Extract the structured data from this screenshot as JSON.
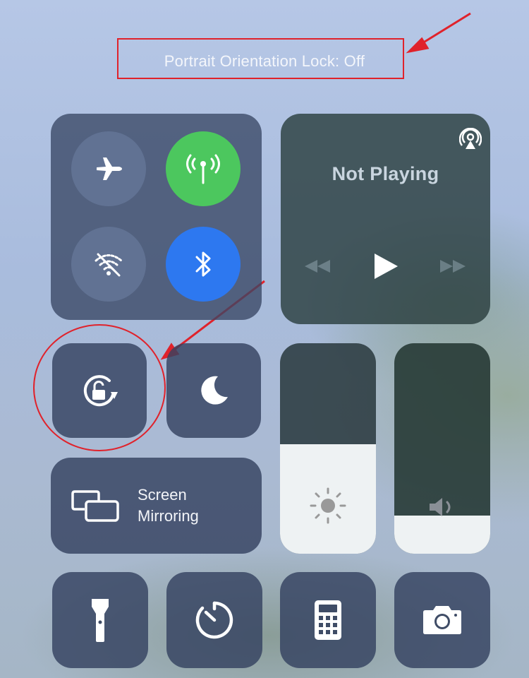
{
  "status": {
    "text": "Portrait Orientation Lock: Off"
  },
  "connectivity": {
    "items": [
      {
        "name": "airplane-mode",
        "icon": "airplane-icon",
        "state": "off"
      },
      {
        "name": "cellular-data",
        "icon": "antenna-icon",
        "state": "on",
        "color": "#4cc75e"
      },
      {
        "name": "wifi",
        "icon": "wifi-off-icon",
        "state": "off"
      },
      {
        "name": "bluetooth",
        "icon": "bluetooth-icon",
        "state": "on",
        "color": "#2d78f0"
      }
    ]
  },
  "media": {
    "title": "Not Playing",
    "icons": [
      "airplay-icon",
      "rewind-icon",
      "play-icon",
      "fast-forward-icon"
    ]
  },
  "orientation_lock": {
    "icon": "rotation-lock-icon",
    "state": "off"
  },
  "do_not_disturb": {
    "icon": "moon-icon"
  },
  "screen_mirroring": {
    "label_line1": "Screen",
    "label_line2": "Mirroring",
    "icon": "screen-mirroring-icon"
  },
  "brightness": {
    "level": 0.52,
    "icon": "sun-icon"
  },
  "volume": {
    "level": 0.18,
    "icon": "speaker-icon"
  },
  "shortcuts": [
    {
      "name": "flashlight",
      "icon": "flashlight-icon"
    },
    {
      "name": "timer",
      "icon": "timer-icon"
    },
    {
      "name": "calculator",
      "icon": "calculator-icon"
    },
    {
      "name": "camera",
      "icon": "camera-icon"
    }
  ],
  "annotation_color": "#e0222b"
}
